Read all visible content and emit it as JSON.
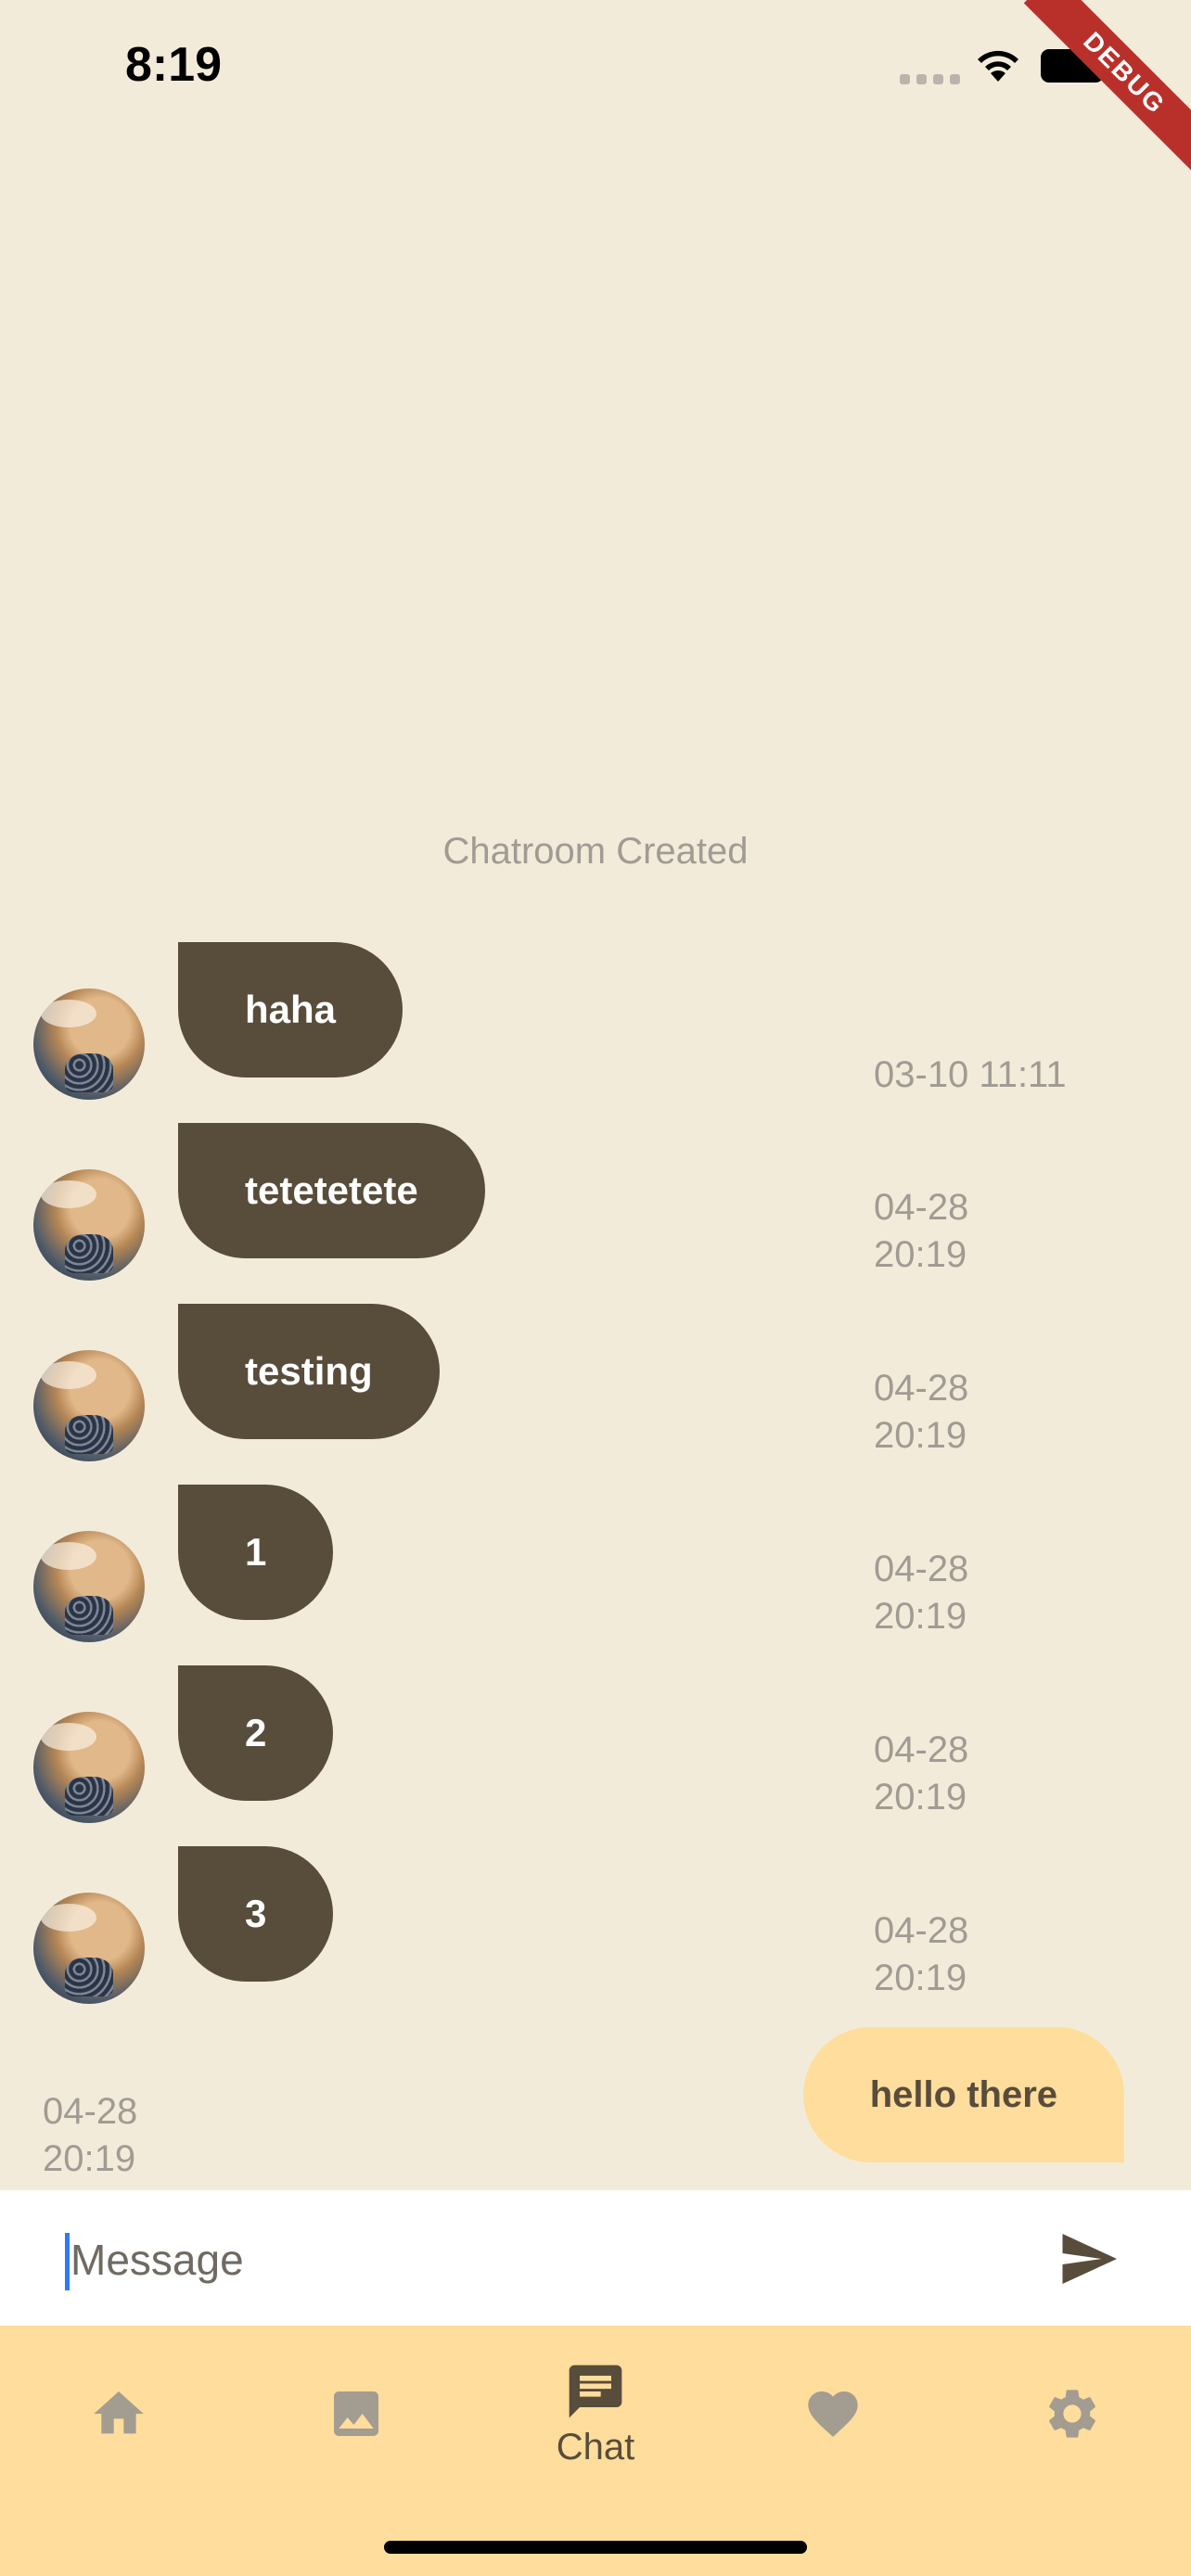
{
  "status_bar": {
    "time": "8:19",
    "debug_label": "DEBUG"
  },
  "chat": {
    "system_message": "Chatroom Created",
    "messages": [
      {
        "text": "haha",
        "time": "03-10 11:11"
      },
      {
        "text": "tetetetete",
        "time_date": "04-28",
        "time_clock": "20:19"
      },
      {
        "text": "testing",
        "time_date": "04-28",
        "time_clock": "20:19"
      },
      {
        "text": "1",
        "time_date": "04-28",
        "time_clock": "20:19"
      },
      {
        "text": "2",
        "time_date": "04-28",
        "time_clock": "20:19"
      },
      {
        "text": "3",
        "time_date": "04-28",
        "time_clock": "20:19"
      }
    ],
    "outgoing": {
      "text": "hello there",
      "time_date": "04-28",
      "time_clock": "20:19"
    }
  },
  "composer": {
    "placeholder": "Message",
    "value": ""
  },
  "nav": {
    "items": [
      {
        "icon": "home-icon",
        "label": ""
      },
      {
        "icon": "image-icon",
        "label": ""
      },
      {
        "icon": "chat-icon",
        "label": "Chat"
      },
      {
        "icon": "heart-icon",
        "label": ""
      },
      {
        "icon": "gear-icon",
        "label": ""
      }
    ],
    "active": "Chat"
  },
  "colors": {
    "background": "#F3EBDA",
    "incoming_bubble": "#584C3B",
    "outgoing_bubble": "#FFDD9C",
    "nav_background": "#FFDD9C",
    "muted_text": "#A09B93",
    "inactive_icon": "#A39C90"
  }
}
